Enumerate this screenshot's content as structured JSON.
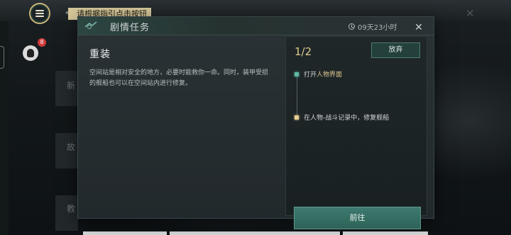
{
  "hud": {
    "hint": "请根据指引点击按钮",
    "collapse_glyph": "«",
    "badge_count": "8"
  },
  "background_list": [
    "新",
    "故",
    "教"
  ],
  "dialog": {
    "title": "剧情任务",
    "timer": "09天23小时",
    "mission_name": "重装",
    "description": "空间站是相对安全的地方，必要时能救你一命。同时，装甲受损的舰船也可以在空间站内进行修复。",
    "progress": "1/2",
    "abandon_label": "放弃",
    "steps": [
      {
        "prefix": "打开",
        "highlight": "人物界面",
        "suffix": ""
      },
      {
        "prefix": "在人物-战斗记录中，修复舰船",
        "highlight": "",
        "suffix": ""
      }
    ],
    "go_label": "前往"
  },
  "colors": {
    "accent_gold": "#e0c98f",
    "accent_teal": "#3e7a6f"
  }
}
